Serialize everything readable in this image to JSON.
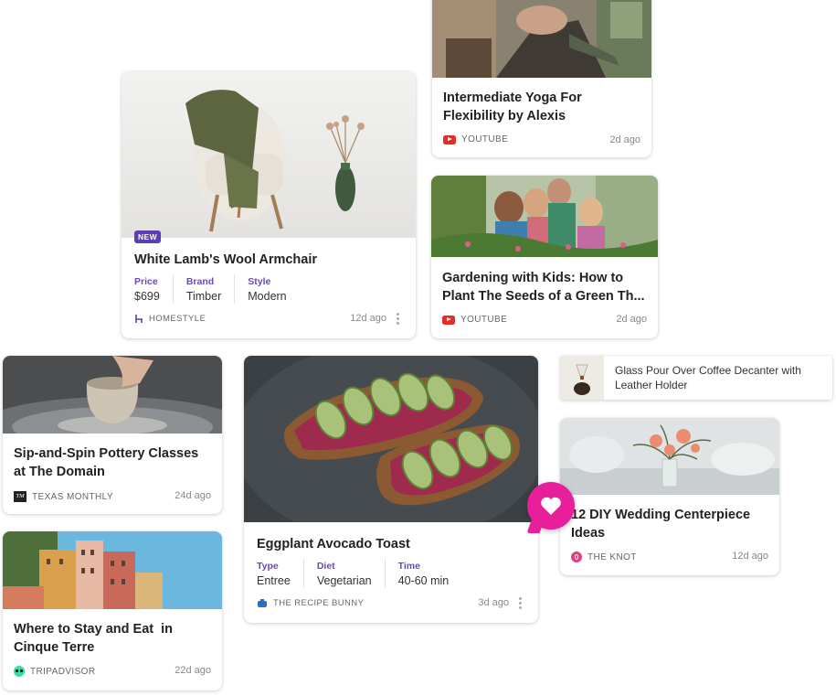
{
  "cards": {
    "yoga": {
      "title": "Intermediate Yoga For Flexibility by Alexis",
      "source": "YOUTUBE",
      "ago": "2d ago"
    },
    "armchair": {
      "badge": "NEW",
      "title": "White Lamb's Wool Armchair",
      "attrs": [
        {
          "k": "Price",
          "v": "$699"
        },
        {
          "k": "Brand",
          "v": "Timber"
        },
        {
          "k": "Style",
          "v": "Modern"
        }
      ],
      "source": "HOMESTYLE",
      "ago": "12d ago"
    },
    "gardening": {
      "title": "Gardening with Kids: How to Plant The Seeds of a Green Th...",
      "source": "YOUTUBE",
      "ago": "2d ago"
    },
    "coffee": {
      "title": "Glass Pour Over Coffee Decanter with Leather Holder"
    },
    "pottery": {
      "title": "Sip-and-Spin Pottery Classes at The Domain",
      "source": "TEXAS MONTHLY",
      "ago": "24d ago"
    },
    "toast": {
      "title": "Eggplant Avocado Toast",
      "attrs": [
        {
          "k": "Type",
          "v": "Entree"
        },
        {
          "k": "Diet",
          "v": "Vegetarian"
        },
        {
          "k": "Time",
          "v": "40-60 min"
        }
      ],
      "source": "THE RECIPE BUNNY",
      "ago": "3d ago"
    },
    "wedding": {
      "title": "12 DIY Wedding Centerpiece Ideas",
      "source": "THE KNOT",
      "ago": "12d ago"
    },
    "cinque": {
      "title": "Where to Stay and Eat  in Cinque Terre",
      "source": "TRIPADVISOR",
      "ago": "22d ago"
    }
  },
  "source_logos": {
    "texas_monthly": "TM"
  },
  "icons": {
    "save": "heart-icon",
    "youtube": "youtube-icon",
    "homestyle": "chair-icon",
    "recipe": "pot-icon",
    "knot": "knot-icon",
    "tripadvisor": "owl-icon"
  },
  "colors": {
    "accent": "#5b3db5",
    "save_bubble": "#e91e9a",
    "youtube": "#e52d27"
  }
}
